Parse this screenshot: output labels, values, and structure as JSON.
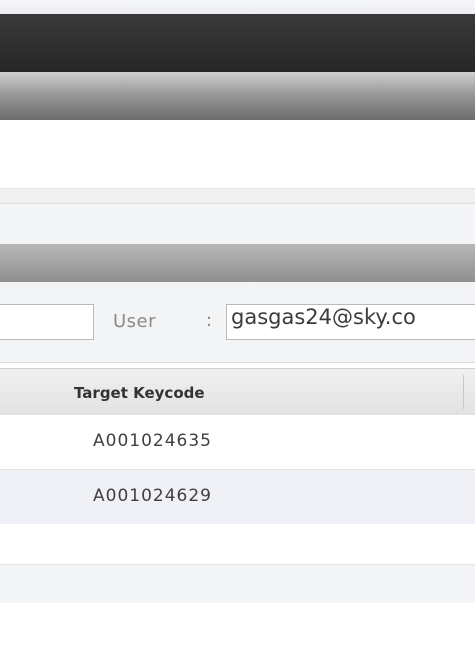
{
  "filter": {
    "left_input_value": "",
    "user_label": "User",
    "user_separator": ":",
    "user_value": "gasgas24@sky.co"
  },
  "table": {
    "columns": [
      "Target Keycode"
    ],
    "rows": [
      {
        "target_keycode": "A001024635"
      },
      {
        "target_keycode": "A001024629"
      }
    ]
  }
}
